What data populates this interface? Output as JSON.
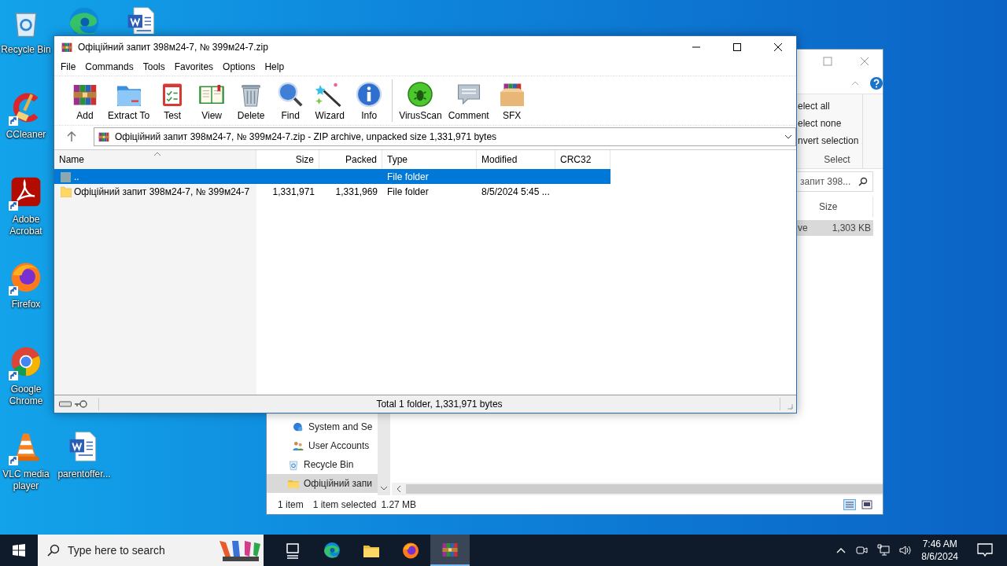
{
  "desktop": {
    "icons": [
      {
        "kind": "recycle-bin",
        "label": "Recycle Bin",
        "shortcut": false
      },
      {
        "kind": "ccleaner",
        "label": "CCleaner",
        "shortcut": true
      },
      {
        "kind": "acrobat",
        "label": "Adobe Acrobat",
        "shortcut": true
      },
      {
        "kind": "firefox",
        "label": "Firefox",
        "shortcut": true
      },
      {
        "kind": "chrome",
        "label": "Google Chrome",
        "shortcut": true
      },
      {
        "kind": "vlc",
        "label": "VLC media player",
        "shortcut": true
      },
      {
        "kind": "edge",
        "shortcut": false
      },
      {
        "kind": "word",
        "shortcut": false
      },
      {
        "kind": "word",
        "label": "parentoffer...",
        "shortcut": false
      }
    ]
  },
  "explorer": {
    "ribbon_items": [
      "elect all",
      "elect none",
      "nvert selection"
    ],
    "ribbon_group": "Select",
    "search": {
      "value": "запит 398..."
    },
    "columns": [
      "Size"
    ],
    "row": {
      "cells": [
        "ve",
        "1,303 KB"
      ],
      "selected": true
    },
    "nav_items": [
      {
        "kind": "shield",
        "label": "System and Se",
        "selected": false
      },
      {
        "kind": "users",
        "label": "User Accounts",
        "selected": false
      },
      {
        "kind": "recycle-bin",
        "label": "Recycle Bin",
        "selected": false
      },
      {
        "kind": "folder",
        "label": "Офіційний запи",
        "selected": true
      }
    ],
    "status": [
      "1 item",
      "1 item selected",
      "1.27 MB"
    ]
  },
  "winrar": {
    "title": "Офіційний запит 398м24-7, № 399м24-7.zip",
    "menu": [
      "File",
      "Commands",
      "Tools",
      "Favorites",
      "Options",
      "Help"
    ],
    "toolbar": [
      [
        {
          "kind": "winrar",
          "label": "Add"
        },
        {
          "kind": "extract",
          "label": "Extract To"
        },
        {
          "kind": "test",
          "label": "Test"
        },
        {
          "kind": "view",
          "label": "View"
        },
        {
          "kind": "delete",
          "label": "Delete"
        },
        {
          "kind": "find",
          "label": "Find"
        },
        {
          "kind": "wizard",
          "label": "Wizard"
        },
        {
          "kind": "info",
          "label": "Info"
        }
      ],
      [
        {
          "kind": "virusscan",
          "label": "VirusScan"
        },
        {
          "kind": "comment",
          "label": "Comment"
        },
        {
          "kind": "sfx",
          "label": "SFX"
        }
      ]
    ],
    "address": "Офіційний запит 398м24-7, № 399м24-7.zip - ZIP archive, unpacked size 1,331,971 bytes",
    "columns": [
      "Name",
      "Size",
      "Packed",
      "Type",
      "Modified",
      "CRC32"
    ],
    "rows": [
      {
        "kind": "parent",
        "name": "..",
        "type": "File folder",
        "selected": true
      },
      {
        "kind": "folder",
        "name": "Офіційний запит 398м24-7, № 399м24-7",
        "size": "1,331,971",
        "packed": "1,331,969",
        "type": "File folder",
        "modified": "8/5/2024 5:45 ...",
        "selected": false
      }
    ],
    "status": "Total 1 folder, 1,331,971 bytes"
  },
  "taskbar": {
    "search": {
      "placeholder": "Type here to search"
    },
    "apps": [
      {
        "kind": "task-view",
        "active": false
      },
      {
        "kind": "edge",
        "active": false
      },
      {
        "kind": "folder",
        "active": false
      },
      {
        "kind": "firefox",
        "active": false
      },
      {
        "kind": "winrar",
        "active": true
      }
    ],
    "time": "7:46 AM",
    "date": "8/6/2024"
  }
}
